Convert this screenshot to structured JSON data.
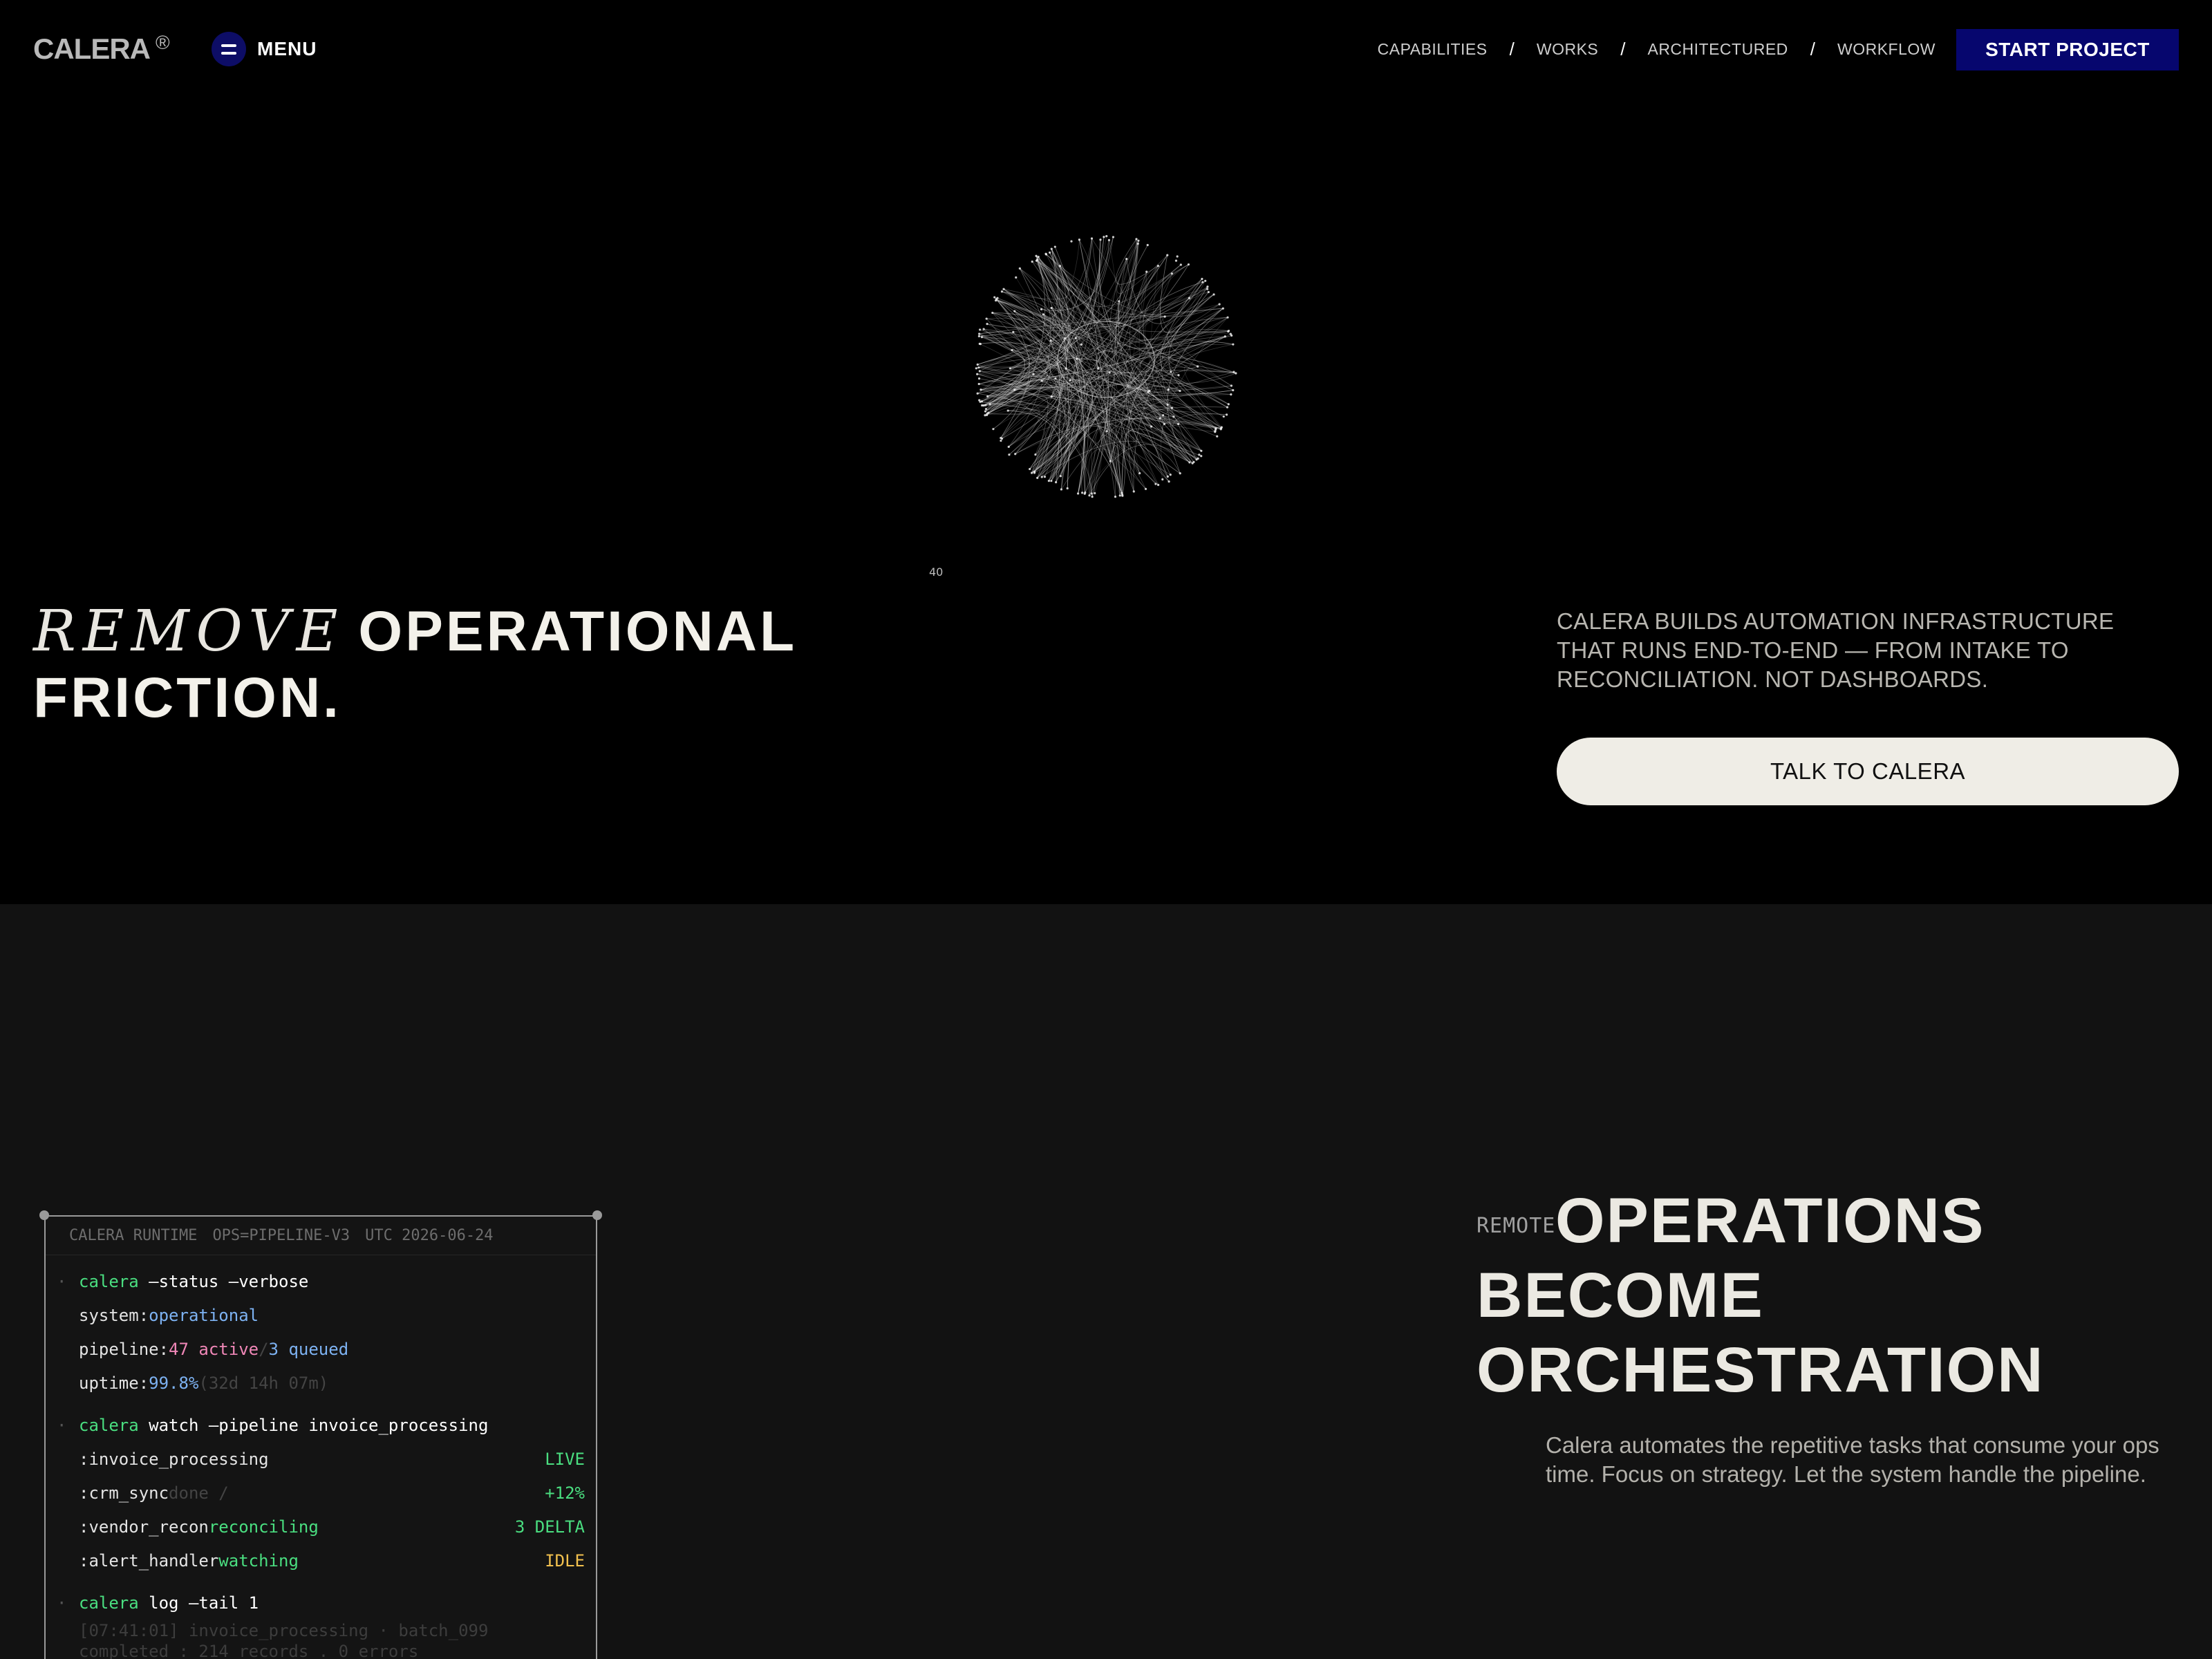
{
  "nav": {
    "logo": "CALERA",
    "logo_mark": "®",
    "menu_label": "MENU",
    "links": [
      "CAPABILITIES",
      "WORKS",
      "ARCHITECTURED",
      "WORKFLOW"
    ],
    "separator": "/",
    "cta": "START PROJECT",
    "accent_color": "#06066e"
  },
  "hero": {
    "counter": "40",
    "headline_script": "REMOVE",
    "headline_bold_1": "OPERATIONAL",
    "headline_bold_2": "FRICTION.",
    "description": "CALERA BUILDS AUTOMATION INFRASTRUCTURE THAT RUNS END-TO-END — FROM INTAKE TO RECONCILIATION. NOT DASHBOARDS.",
    "cta": "TALK TO CALERA"
  },
  "terminal": {
    "header": [
      "CALERA RUNTIME",
      "OPS=PIPELINE-V3",
      "UTC 2026-06-24"
    ],
    "cmd1": "calera",
    "cmd1_args": " —status —verbose",
    "system_label": "system:",
    "system_value": "operational",
    "pipeline_label": "pipeline:",
    "pipeline_active": "47 active",
    "pipeline_sep": "/",
    "pipeline_queued": "3 queued",
    "uptime_label": "uptime:",
    "uptime_value": "99.8%",
    "uptime_detail": "(32d 14h 07m)",
    "cmd2": "calera",
    "cmd2_args": " watch —pipeline invoice_processing",
    "jobs": [
      {
        "name": ":invoice_processing",
        "state": "",
        "badge": "LIVE"
      },
      {
        "name": ":crm_sync",
        "state": "done /",
        "badge": "+12%"
      },
      {
        "name": ":vendor_recon",
        "state": "reconciling",
        "badge": "3 DELTA"
      },
      {
        "name": ":alert_handler",
        "state": "watching",
        "badge": "IDLE"
      }
    ],
    "cmd3": "calera",
    "cmd3_args": " log —tail 1",
    "log_line1": "[07:41:01] invoice_processing · batch_099",
    "log_line2": "completed : 214 records . 0 errors"
  },
  "section2": {
    "label": "REMOTE",
    "title_1": "OPERATIONS",
    "title_2": "BECOME",
    "title_3": "ORCHESTRATION",
    "description": "Calera automates the repetitive tasks that consume your ops time. Focus on strategy. Let the system handle the pipeline."
  }
}
